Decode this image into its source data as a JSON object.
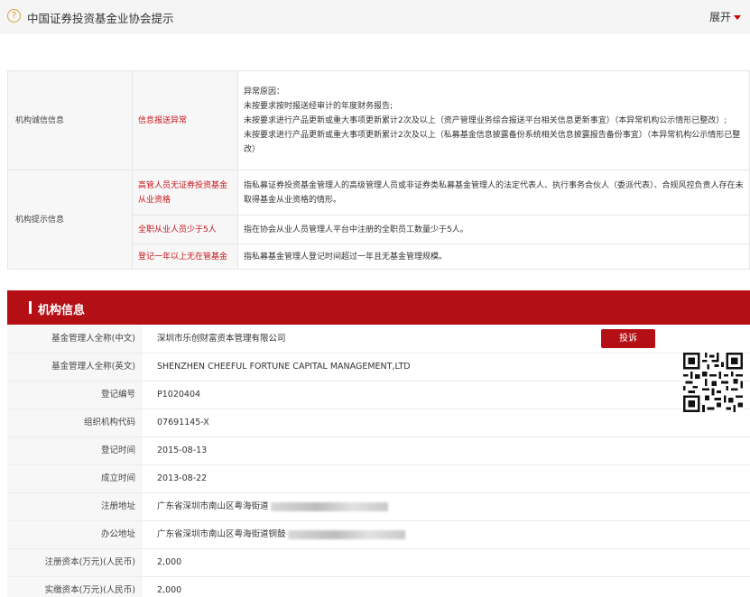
{
  "notice": {
    "icon": "question-circle-icon",
    "title": "中国证券投资基金业协会提示",
    "expand_label": "展开"
  },
  "integrity": {
    "category": "机构诚信信息",
    "item": "信息报送异常",
    "reason_lines": [
      "异常原因：",
      "未按要求按时报送经审计的年度财务报告;",
      "未按要求进行产品更新或重大事项更新累计2次及以上（资产管理业务综合报送平台相关信息更新事宜）（本异常机构公示情形已整改）;",
      "未按要求进行产品更新或重大事项更新累计2次及以上（私募基金信息披露备份系统相关信息披露报告备份事宜）（本异常机构公示情形已整改）"
    ]
  },
  "hints": {
    "category": "机构提示信息",
    "items": [
      {
        "name": "高管人员无证券投资基金从业资格",
        "desc": "指私募证券投资基金管理人的高级管理人员或非证券类私募基金管理人的法定代表人、执行事务合伙人（委派代表）、合规风控负责人存在未取得基金从业资格的情形。"
      },
      {
        "name": "全职从业人员少于5人",
        "desc": "指在协会从业人员管理人平台中注册的全职员工数量少于5人。"
      },
      {
        "name": "登记一年以上无在管基金",
        "desc": "指私募基金管理人登记时间超过一年且无基金管理规模。"
      }
    ]
  },
  "org": {
    "title": "机构信息",
    "complain_label": "投诉",
    "qr_icon": "qr-code-icon",
    "fields": [
      {
        "label": "基金管理人全称(中文)",
        "value": "深圳市乐创财富资本管理有限公司"
      },
      {
        "label": "基金管理人全称(英文)",
        "value": "SHENZHEN CHEEFUL FORTUNE CAPITAL MANAGEMENT,LTD"
      },
      {
        "label": "登记编号",
        "value": "P1020404"
      },
      {
        "label": "组织机构代码",
        "value": "07691145-X"
      },
      {
        "label": "登记时间",
        "value": "2015-08-13"
      },
      {
        "label": "成立时间",
        "value": "2013-08-22"
      },
      {
        "label": "注册地址",
        "value": "广东省深圳市南山区粤海街道"
      },
      {
        "label": "办公地址",
        "value": "广东省深圳市南山区粤海街道铜鼓"
      },
      {
        "label": "注册资本(万元)(人民币)",
        "value": "2,000"
      },
      {
        "label": "实缴资本(万元)(人民币)",
        "value": "2,000"
      }
    ]
  }
}
